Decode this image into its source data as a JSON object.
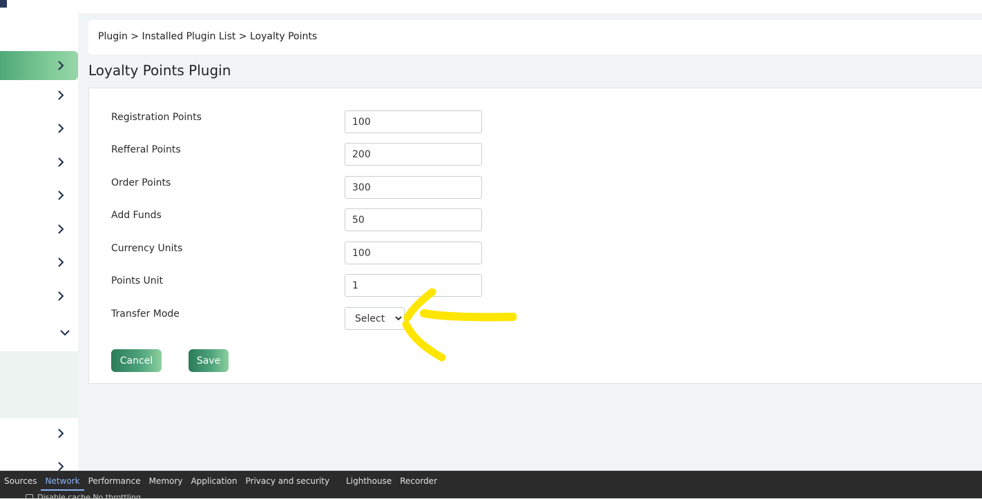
{
  "breadcrumb": "Plugin > Installed Plugin List > Loyalty Points",
  "page_title": "Loyalty Points Plugin",
  "form": {
    "fields": [
      {
        "label": "Registration Points",
        "value": "100"
      },
      {
        "label": "Refferal Points",
        "value": "200"
      },
      {
        "label": "Order Points",
        "value": "300"
      },
      {
        "label": "Add Funds",
        "value": "50"
      },
      {
        "label": "Currency Units",
        "value": "100"
      },
      {
        "label": "Points Unit",
        "value": "1"
      }
    ],
    "transfer_mode": {
      "label": "Transfer Mode",
      "selected": "Select"
    },
    "cancel_label": "Cancel",
    "save_label": "Save"
  },
  "devtools": {
    "tabs": [
      "Sources",
      "Network",
      "Performance",
      "Memory",
      "Application",
      "Privacy and security",
      "Lighthouse",
      "Recorder"
    ],
    "active_tab": "Network",
    "toolbar_text": "Disable cache   No throttling"
  },
  "colors": {
    "accent_green": "#4fa878",
    "annotation_yellow": "#ffe500",
    "devtools_active": "#8ab4f8"
  },
  "icons": {
    "sidebar": [
      "chevron-right-icon",
      "chevron-down-icon"
    ]
  }
}
